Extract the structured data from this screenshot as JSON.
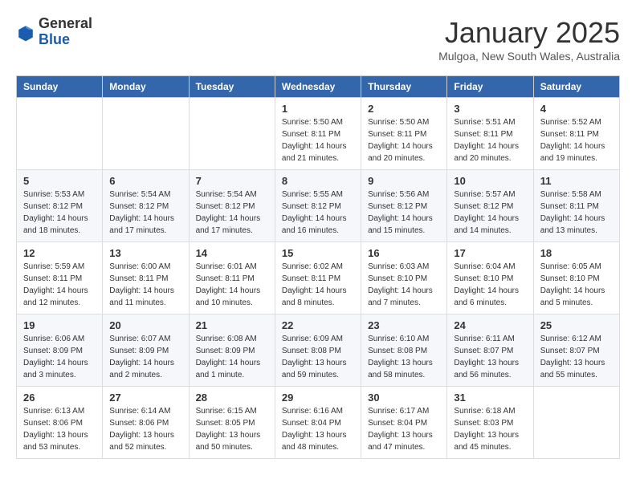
{
  "header": {
    "logo_general": "General",
    "logo_blue": "Blue",
    "month_title": "January 2025",
    "location": "Mulgoa, New South Wales, Australia"
  },
  "weekdays": [
    "Sunday",
    "Monday",
    "Tuesday",
    "Wednesday",
    "Thursday",
    "Friday",
    "Saturday"
  ],
  "weeks": [
    [
      {
        "day": "",
        "info": ""
      },
      {
        "day": "",
        "info": ""
      },
      {
        "day": "",
        "info": ""
      },
      {
        "day": "1",
        "info": "Sunrise: 5:50 AM\nSunset: 8:11 PM\nDaylight: 14 hours\nand 21 minutes."
      },
      {
        "day": "2",
        "info": "Sunrise: 5:50 AM\nSunset: 8:11 PM\nDaylight: 14 hours\nand 20 minutes."
      },
      {
        "day": "3",
        "info": "Sunrise: 5:51 AM\nSunset: 8:11 PM\nDaylight: 14 hours\nand 20 minutes."
      },
      {
        "day": "4",
        "info": "Sunrise: 5:52 AM\nSunset: 8:11 PM\nDaylight: 14 hours\nand 19 minutes."
      }
    ],
    [
      {
        "day": "5",
        "info": "Sunrise: 5:53 AM\nSunset: 8:12 PM\nDaylight: 14 hours\nand 18 minutes."
      },
      {
        "day": "6",
        "info": "Sunrise: 5:54 AM\nSunset: 8:12 PM\nDaylight: 14 hours\nand 17 minutes."
      },
      {
        "day": "7",
        "info": "Sunrise: 5:54 AM\nSunset: 8:12 PM\nDaylight: 14 hours\nand 17 minutes."
      },
      {
        "day": "8",
        "info": "Sunrise: 5:55 AM\nSunset: 8:12 PM\nDaylight: 14 hours\nand 16 minutes."
      },
      {
        "day": "9",
        "info": "Sunrise: 5:56 AM\nSunset: 8:12 PM\nDaylight: 14 hours\nand 15 minutes."
      },
      {
        "day": "10",
        "info": "Sunrise: 5:57 AM\nSunset: 8:12 PM\nDaylight: 14 hours\nand 14 minutes."
      },
      {
        "day": "11",
        "info": "Sunrise: 5:58 AM\nSunset: 8:11 PM\nDaylight: 14 hours\nand 13 minutes."
      }
    ],
    [
      {
        "day": "12",
        "info": "Sunrise: 5:59 AM\nSunset: 8:11 PM\nDaylight: 14 hours\nand 12 minutes."
      },
      {
        "day": "13",
        "info": "Sunrise: 6:00 AM\nSunset: 8:11 PM\nDaylight: 14 hours\nand 11 minutes."
      },
      {
        "day": "14",
        "info": "Sunrise: 6:01 AM\nSunset: 8:11 PM\nDaylight: 14 hours\nand 10 minutes."
      },
      {
        "day": "15",
        "info": "Sunrise: 6:02 AM\nSunset: 8:11 PM\nDaylight: 14 hours\nand 8 minutes."
      },
      {
        "day": "16",
        "info": "Sunrise: 6:03 AM\nSunset: 8:10 PM\nDaylight: 14 hours\nand 7 minutes."
      },
      {
        "day": "17",
        "info": "Sunrise: 6:04 AM\nSunset: 8:10 PM\nDaylight: 14 hours\nand 6 minutes."
      },
      {
        "day": "18",
        "info": "Sunrise: 6:05 AM\nSunset: 8:10 PM\nDaylight: 14 hours\nand 5 minutes."
      }
    ],
    [
      {
        "day": "19",
        "info": "Sunrise: 6:06 AM\nSunset: 8:09 PM\nDaylight: 14 hours\nand 3 minutes."
      },
      {
        "day": "20",
        "info": "Sunrise: 6:07 AM\nSunset: 8:09 PM\nDaylight: 14 hours\nand 2 minutes."
      },
      {
        "day": "21",
        "info": "Sunrise: 6:08 AM\nSunset: 8:09 PM\nDaylight: 14 hours\nand 1 minute."
      },
      {
        "day": "22",
        "info": "Sunrise: 6:09 AM\nSunset: 8:08 PM\nDaylight: 13 hours\nand 59 minutes."
      },
      {
        "day": "23",
        "info": "Sunrise: 6:10 AM\nSunset: 8:08 PM\nDaylight: 13 hours\nand 58 minutes."
      },
      {
        "day": "24",
        "info": "Sunrise: 6:11 AM\nSunset: 8:07 PM\nDaylight: 13 hours\nand 56 minutes."
      },
      {
        "day": "25",
        "info": "Sunrise: 6:12 AM\nSunset: 8:07 PM\nDaylight: 13 hours\nand 55 minutes."
      }
    ],
    [
      {
        "day": "26",
        "info": "Sunrise: 6:13 AM\nSunset: 8:06 PM\nDaylight: 13 hours\nand 53 minutes."
      },
      {
        "day": "27",
        "info": "Sunrise: 6:14 AM\nSunset: 8:06 PM\nDaylight: 13 hours\nand 52 minutes."
      },
      {
        "day": "28",
        "info": "Sunrise: 6:15 AM\nSunset: 8:05 PM\nDaylight: 13 hours\nand 50 minutes."
      },
      {
        "day": "29",
        "info": "Sunrise: 6:16 AM\nSunset: 8:04 PM\nDaylight: 13 hours\nand 48 minutes."
      },
      {
        "day": "30",
        "info": "Sunrise: 6:17 AM\nSunset: 8:04 PM\nDaylight: 13 hours\nand 47 minutes."
      },
      {
        "day": "31",
        "info": "Sunrise: 6:18 AM\nSunset: 8:03 PM\nDaylight: 13 hours\nand 45 minutes."
      },
      {
        "day": "",
        "info": ""
      }
    ]
  ]
}
